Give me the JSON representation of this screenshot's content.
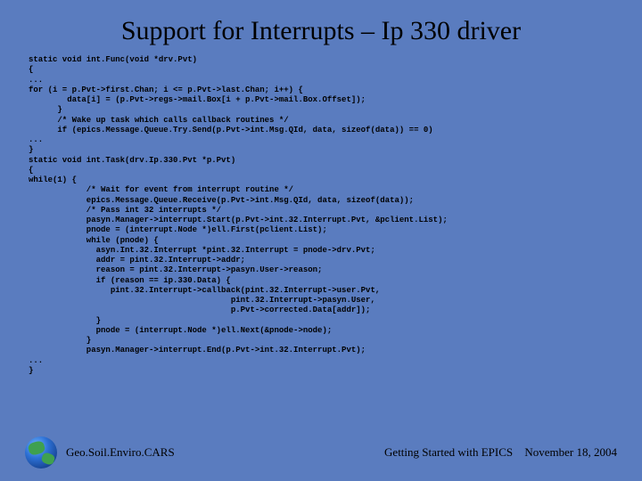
{
  "title": "Support for Interrupts – Ip 330 driver",
  "code": "static void int.Func(void *drv.Pvt)\n{\n...\nfor (i = p.Pvt->first.Chan; i <= p.Pvt->last.Chan; i++) {\n        data[i] = (p.Pvt->regs->mail.Box[i + p.Pvt->mail.Box.Offset]);\n      }\n      /* Wake up task which calls callback routines */\n      if (epics.Message.Queue.Try.Send(p.Pvt->int.Msg.QId, data, sizeof(data)) == 0)\n...\n}\nstatic void int.Task(drv.Ip.330.Pvt *p.Pvt)\n{\nwhile(1) {\n            /* Wait for event from interrupt routine */\n            epics.Message.Queue.Receive(p.Pvt->int.Msg.QId, data, sizeof(data));\n            /* Pass int 32 interrupts */\n            pasyn.Manager->interrupt.Start(p.Pvt->int.32.Interrupt.Pvt, &pclient.List);\n            pnode = (interrupt.Node *)ell.First(pclient.List);\n            while (pnode) {\n              asyn.Int.32.Interrupt *pint.32.Interrupt = pnode->drv.Pvt;\n              addr = pint.32.Interrupt->addr;\n              reason = pint.32.Interrupt->pasyn.User->reason;\n              if (reason == ip.330.Data) {\n                 pint.32.Interrupt->callback(pint.32.Interrupt->user.Pvt,\n                                          pint.32.Interrupt->pasyn.User,\n                                          p.Pvt->corrected.Data[addr]);\n              }\n              pnode = (interrupt.Node *)ell.Next(&pnode->node);\n            }\n            pasyn.Manager->interrupt.End(p.Pvt->int.32.Interrupt.Pvt);\n...\n}",
  "footer": {
    "left": "Geo.Soil.Enviro.CARS",
    "right": "Getting Started with EPICS",
    "date": "November 18, 2004"
  }
}
